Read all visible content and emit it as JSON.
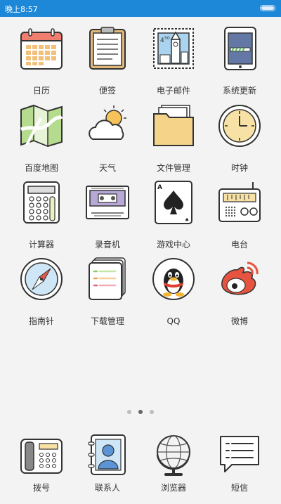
{
  "status_bar": {
    "time": "晚上8:57",
    "battery_icon": "battery-icon"
  },
  "apps": [
    {
      "label": "日历",
      "icon": "calendar-icon"
    },
    {
      "label": "便签",
      "icon": "notes-icon"
    },
    {
      "label": "电子邮件",
      "icon": "mail-stamp-icon"
    },
    {
      "label": "系统更新",
      "icon": "system-update-icon"
    },
    {
      "label": "百度地图",
      "icon": "map-icon"
    },
    {
      "label": "天气",
      "icon": "weather-icon"
    },
    {
      "label": "文件管理",
      "icon": "folder-icon"
    },
    {
      "label": "时钟",
      "icon": "clock-icon"
    },
    {
      "label": "计算器",
      "icon": "calculator-icon"
    },
    {
      "label": "录音机",
      "icon": "cassette-icon"
    },
    {
      "label": "游戏中心",
      "icon": "game-card-icon"
    },
    {
      "label": "电台",
      "icon": "radio-icon"
    },
    {
      "label": "指南针",
      "icon": "compass-icon"
    },
    {
      "label": "下载管理",
      "icon": "download-list-icon"
    },
    {
      "label": "QQ",
      "icon": "qq-penguin-icon"
    },
    {
      "label": "微博",
      "icon": "weibo-icon"
    }
  ],
  "page_indicator": {
    "pages": 3,
    "current": 2
  },
  "dock": [
    {
      "label": "拨号",
      "icon": "phone-icon"
    },
    {
      "label": "联系人",
      "icon": "contacts-icon"
    },
    {
      "label": "浏览器",
      "icon": "globe-icon"
    },
    {
      "label": "短信",
      "icon": "message-icon"
    }
  ]
}
